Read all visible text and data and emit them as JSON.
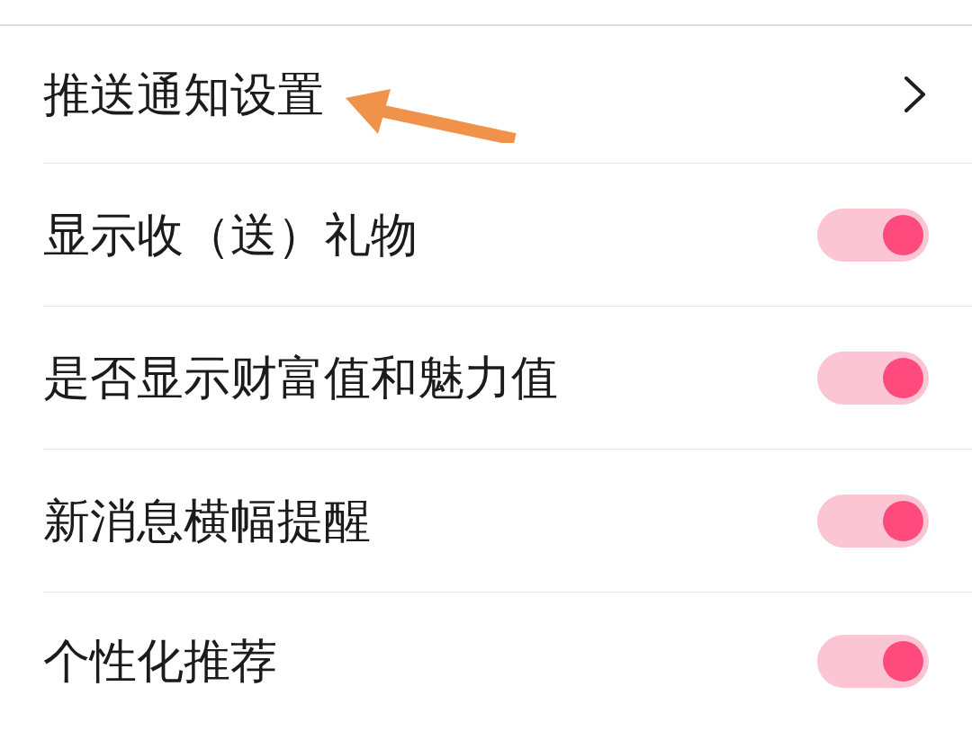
{
  "items": [
    {
      "kind": "link",
      "label": "推送通知设置",
      "annotated": true
    },
    {
      "kind": "toggle",
      "label": "显示收（送）礼物",
      "on": true,
      "annotated": false
    },
    {
      "kind": "toggle",
      "label": "是否显示财富值和魅力值",
      "on": true,
      "annotated": false
    },
    {
      "kind": "toggle",
      "label": "新消息横幅提醒",
      "on": true,
      "annotated": false
    },
    {
      "kind": "toggle",
      "label": "个性化推荐",
      "on": true,
      "annotated": false
    }
  ]
}
